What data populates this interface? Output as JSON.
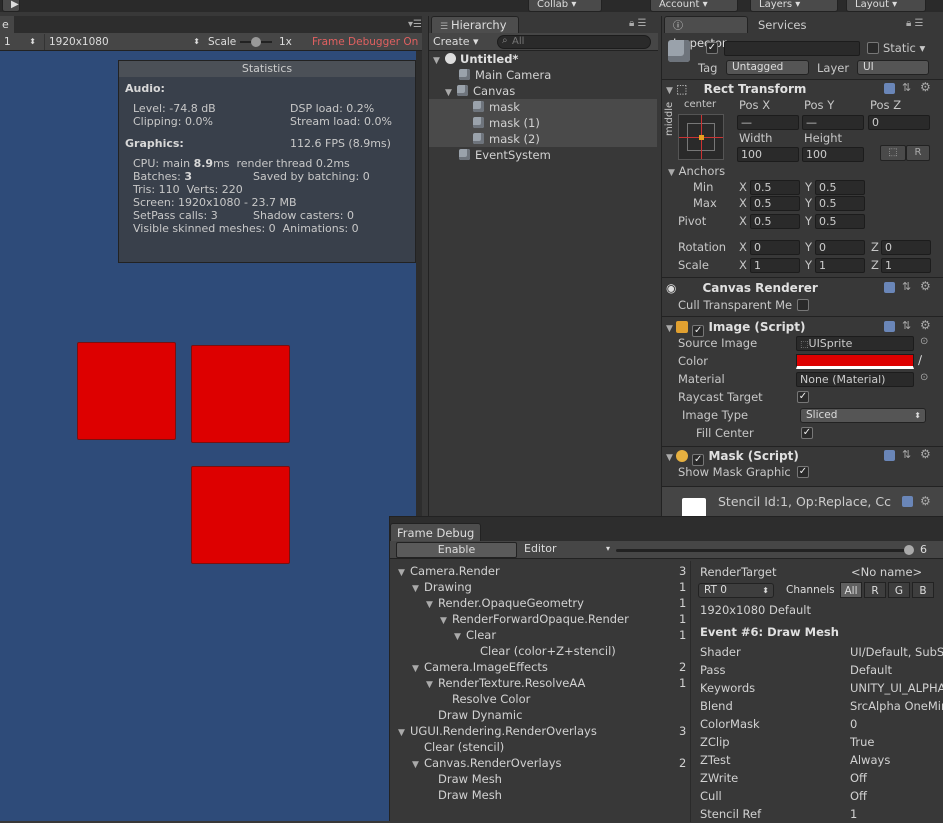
{
  "topbar": {
    "collab": "Collab",
    "account": "Account",
    "layers": "Layers",
    "layout": "Layout"
  },
  "game": {
    "tab_label": "e",
    "display": "1",
    "resolution": "1920x1080",
    "scale_label": "Scale",
    "scale_value": "1x",
    "frame_debugger": "Frame Debugger On"
  },
  "stats": {
    "title": "Statistics",
    "audio_heading": "Audio:",
    "level": "Level: -74.8 dB",
    "dsp": "DSP load: 0.2%",
    "clipping": "Clipping: 0.0%",
    "stream": "Stream load: 0.0%",
    "graphics_heading": "Graphics:",
    "fps": "112.6 FPS (8.9ms)",
    "cpu_prefix": "CPU: main ",
    "cpu_main": "8.9",
    "cpu_suffix": "ms  render thread 0.2ms",
    "batches_prefix": "Batches: ",
    "batches": "3",
    "saved": "Saved by batching: 0",
    "tris": "Tris: 110  Verts: 220",
    "screen": "Screen: 1920x1080 - 23.7 MB",
    "setpass": "SetPass calls: 3",
    "shadow": "Shadow casters: 0",
    "skinned": "Visible skinned meshes: 0  Animations: 0"
  },
  "hierarchy": {
    "tab": "Hierarchy",
    "create": "Create",
    "search_placeholder": "All",
    "scene": "Untitled*",
    "items": [
      "Main Camera",
      "Canvas",
      "mask",
      "mask (1)",
      "mask (2)",
      "EventSystem"
    ]
  },
  "inspector": {
    "tab": "Inspector",
    "services_tab": "Services",
    "name_value": "",
    "static_label": "Static",
    "tag_label": "Tag",
    "tag_value": "Untagged",
    "layer_label": "Layer",
    "layer_value": "UI",
    "rect": {
      "title": "Rect Transform",
      "anchor_h": "center",
      "anchor_v": "middle",
      "posx_label": "Pos X",
      "posy_label": "Pos Y",
      "posz_label": "Pos Z",
      "posx": "—",
      "posy": "—",
      "posz": "0",
      "width_label": "Width",
      "height_label": "Height",
      "width": "100",
      "height": "100",
      "r_button": "R",
      "anchors_label": "Anchors",
      "min_label": "Min",
      "max_label": "Max",
      "min_x": "0.5",
      "min_y": "0.5",
      "max_x": "0.5",
      "max_y": "0.5",
      "pivot_label": "Pivot",
      "pivot_x": "0.5",
      "pivot_y": "0.5",
      "rotation_label": "Rotation",
      "rot_x": "0",
      "rot_y": "0",
      "rot_z": "0",
      "scale_label": "Scale",
      "scale_x": "1",
      "scale_y": "1",
      "scale_z": "1",
      "x": "X",
      "y": "Y",
      "z": "Z"
    },
    "canvas_renderer": {
      "title": "Canvas Renderer",
      "cull_label": "Cull Transparent Me"
    },
    "image": {
      "title": "Image (Script)",
      "source_label": "Source Image",
      "source_value": "UISprite",
      "color_label": "Color",
      "color_value": "#dd0000",
      "material_label": "Material",
      "material_value": "None (Material)",
      "raycast_label": "Raycast Target",
      "type_label": "Image Type",
      "type_value": "Sliced",
      "fill_label": "Fill Center"
    },
    "mask": {
      "title": "Mask (Script)",
      "show_label": "Show Mask Graphic"
    },
    "stencil": "Stencil Id:1, Op:Replace, Cc"
  },
  "frame_debug": {
    "tab": "Frame Debug",
    "enable": "Enable",
    "editor": "Editor",
    "slider_value": "6",
    "tree": [
      {
        "label": "Camera.Render",
        "count": "3",
        "indent": 0,
        "arrow": true
      },
      {
        "label": "Drawing",
        "count": "1",
        "indent": 1,
        "arrow": true
      },
      {
        "label": "Render.OpaqueGeometry",
        "count": "1",
        "indent": 2,
        "arrow": true
      },
      {
        "label": "RenderForwardOpaque.Render",
        "count": "1",
        "indent": 3,
        "arrow": true
      },
      {
        "label": "Clear",
        "count": "1",
        "indent": 4,
        "arrow": true
      },
      {
        "label": "Clear (color+Z+stencil)",
        "count": "",
        "indent": 5,
        "arrow": false
      },
      {
        "label": "Camera.ImageEffects",
        "count": "2",
        "indent": 1,
        "arrow": true
      },
      {
        "label": "RenderTexture.ResolveAA",
        "count": "1",
        "indent": 2,
        "arrow": true
      },
      {
        "label": "Resolve Color",
        "count": "",
        "indent": 3,
        "arrow": false
      },
      {
        "label": "Draw Dynamic",
        "count": "",
        "indent": 2,
        "arrow": false
      },
      {
        "label": "UGUI.Rendering.RenderOverlays",
        "count": "3",
        "indent": 0,
        "arrow": true
      },
      {
        "label": "Clear (stencil)",
        "count": "",
        "indent": 1,
        "arrow": false
      },
      {
        "label": "Canvas.RenderOverlays",
        "count": "2",
        "indent": 1,
        "arrow": true
      },
      {
        "label": "Draw Mesh",
        "count": "",
        "indent": 2,
        "arrow": false
      },
      {
        "label": "Draw Mesh",
        "count": "",
        "indent": 2,
        "arrow": false
      }
    ],
    "render_target_label": "RenderTarget",
    "render_target_value": "<No name>",
    "rt_select": "RT 0",
    "channels_label": "Channels",
    "channels": [
      "All",
      "R",
      "G",
      "B"
    ],
    "resolution": "1920x1080 Default",
    "event_title": "Event #6: Draw Mesh",
    "props": [
      {
        "k": "Shader",
        "v": "UI/Default, SubS"
      },
      {
        "k": "Pass",
        "v": "Default"
      },
      {
        "k": "Keywords",
        "v": "UNITY_UI_ALPHA"
      },
      {
        "k": "Blend",
        "v": "SrcAlpha OneMin"
      },
      {
        "k": "ColorMask",
        "v": "0"
      },
      {
        "k": "ZClip",
        "v": "True"
      },
      {
        "k": "ZTest",
        "v": "Always"
      },
      {
        "k": "ZWrite",
        "v": "Off"
      },
      {
        "k": "Cull",
        "v": "Off"
      },
      {
        "k": "Stencil Ref",
        "v": "1"
      }
    ]
  }
}
